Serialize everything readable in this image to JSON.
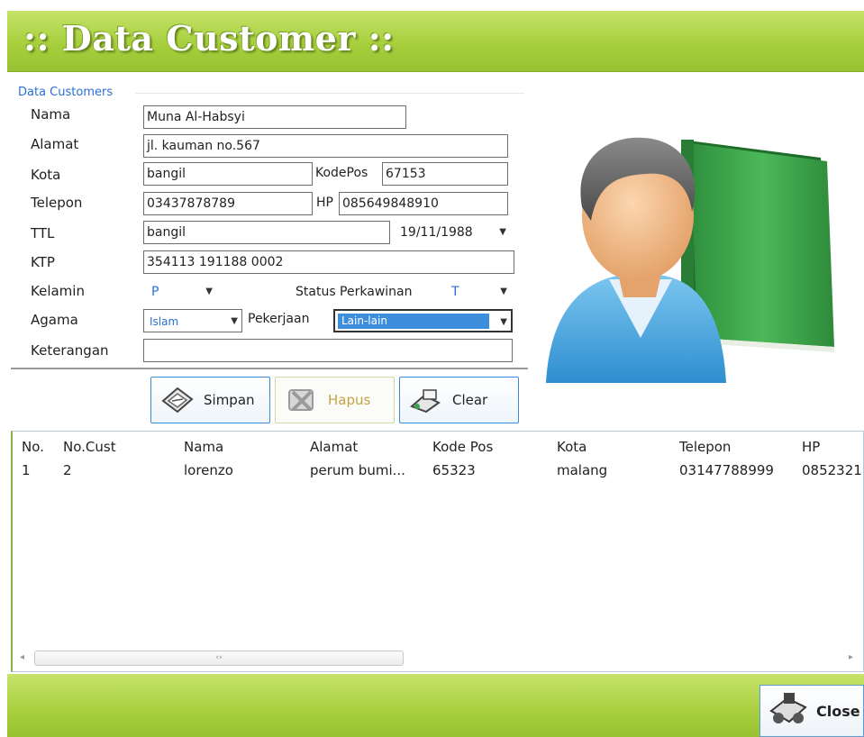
{
  "window": {
    "title": ":: Data Customer ::"
  },
  "form": {
    "group_title": "Data Customers",
    "labels": {
      "nama": "Nama",
      "alamat": "Alamat",
      "kota": "Kota",
      "kodepos": "KodePos",
      "telepon": "Telepon",
      "hp": "HP",
      "ttl": "TTL",
      "ktp": "KTP",
      "kelamin": "Kelamin",
      "status_perkawinan": "Status Perkawinan",
      "agama": "Agama",
      "pekerjaan": "Pekerjaan",
      "keterangan": "Keterangan"
    },
    "values": {
      "nama": "Muna Al-Habsyi",
      "alamat": "jl. kauman no.567",
      "kota": "bangil",
      "kodepos": "67153",
      "telepon": "03437878789",
      "hp": "085649848910",
      "tempat_lahir": "bangil",
      "tanggal_lahir": "19/11/1988",
      "ktp": "354113 191188 0002",
      "kelamin": "P",
      "status_perkawinan": "T",
      "agama": "Islam",
      "pekerjaan": "Lain-lain",
      "keterangan": ""
    }
  },
  "buttons": {
    "simpan": "Simpan",
    "hapus": "Hapus",
    "clear": "Clear",
    "close": "Close"
  },
  "table": {
    "columns": [
      "No.",
      "No.Cust",
      "Nama",
      "Alamat",
      "Kode Pos",
      "Kota",
      "Telepon",
      "HP"
    ],
    "rows": [
      [
        "1",
        "2",
        "lorenzo",
        "perum bumi...",
        "65323",
        "malang",
        "03147788999",
        "0852321"
      ]
    ]
  },
  "icons": {
    "user_avatar": "user-with-book-icon",
    "simpan": "save-icon",
    "hapus": "delete-icon",
    "clear": "clear-icon",
    "close": "close-icon"
  },
  "colors": {
    "title_bar": "#a8cf3d",
    "accent_blue": "#2a6fd6",
    "selection": "#3d8fdd",
    "book_green": "#3aa24a"
  }
}
